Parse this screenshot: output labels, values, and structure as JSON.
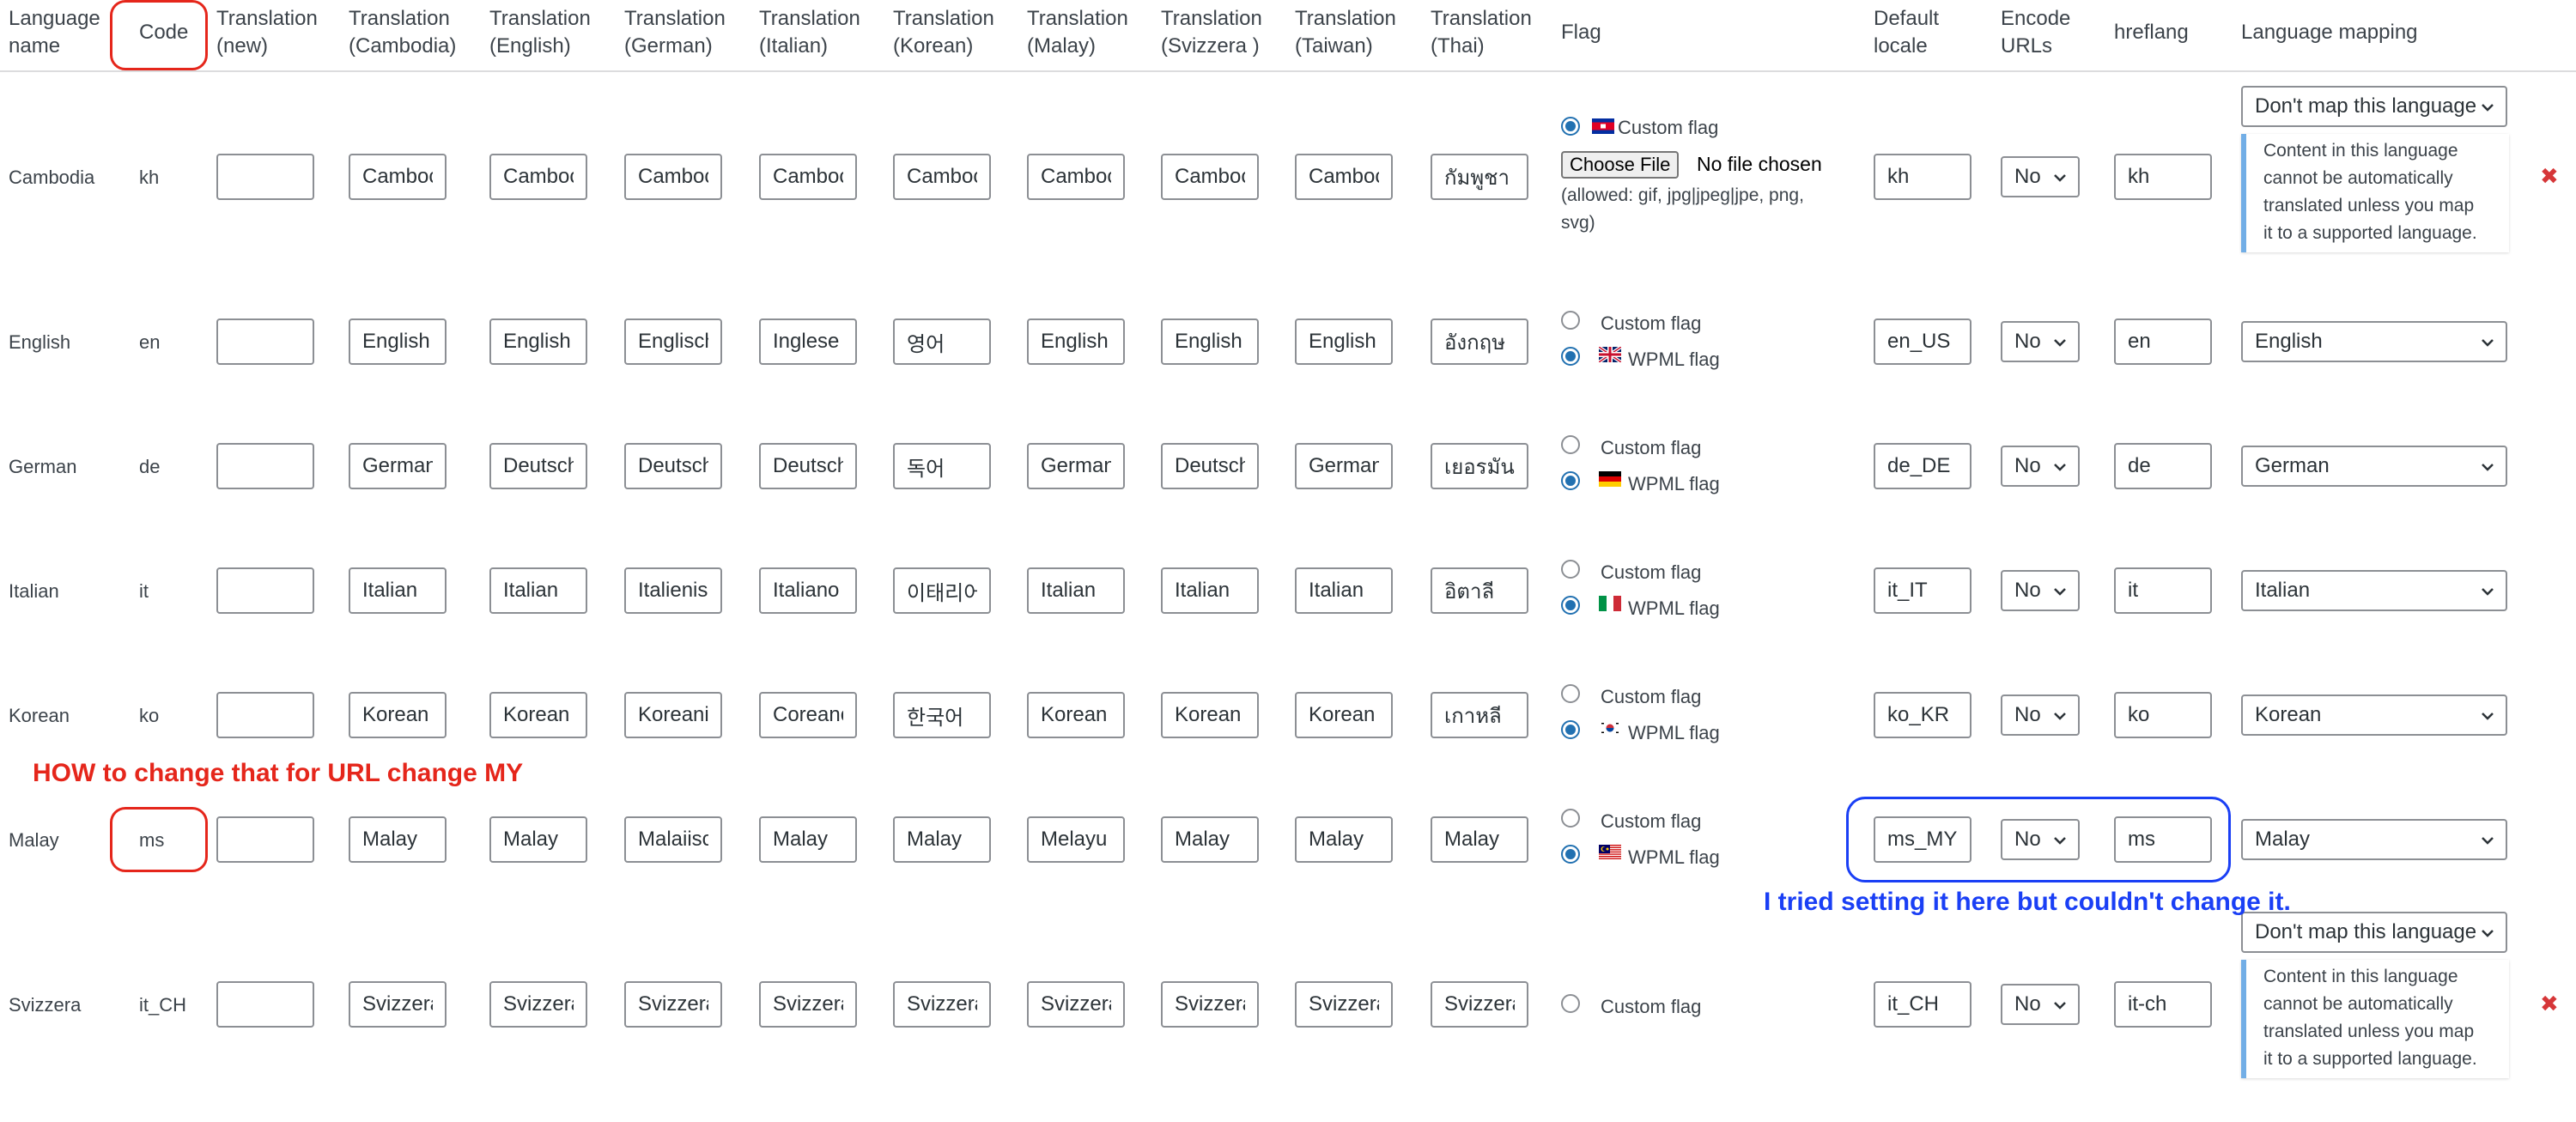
{
  "headers": {
    "name": [
      "Language",
      "name"
    ],
    "code": [
      "Code"
    ],
    "t_new": [
      "Translation",
      "(new)"
    ],
    "t_cambodia": [
      "Translation",
      "(Cambodia)"
    ],
    "t_english": [
      "Translation",
      "(English)"
    ],
    "t_german": [
      "Translation",
      "(German)"
    ],
    "t_italian": [
      "Translation",
      "(Italian)"
    ],
    "t_korean": [
      "Translation",
      "(Korean)"
    ],
    "t_malay": [
      "Translation",
      "(Malay)"
    ],
    "t_svizzera": [
      "Translation",
      "(Svizzera )"
    ],
    "t_taiwan": [
      "Translation",
      "(Taiwan)"
    ],
    "t_thai": [
      "Translation",
      "(Thai)"
    ],
    "flag": [
      "Flag"
    ],
    "locale": [
      "Default",
      "locale"
    ],
    "encode": [
      "Encode",
      "URLs"
    ],
    "hreflang": [
      "hreflang"
    ],
    "mapping": [
      "Language mapping"
    ]
  },
  "flag_labels": {
    "custom": "Custom flag",
    "wpml": "WPML flag",
    "choose_file": "Choose File",
    "no_file": "No file chosen",
    "allowed_1": "(allowed: gif, jpg|jpeg|jpe, png,",
    "allowed_2": "svg)"
  },
  "mapping_note": [
    "Content in this language",
    "cannot be automatically",
    "translated unless you map",
    "it to a supported language."
  ],
  "rows": [
    {
      "name": "Cambodia",
      "code": "kh",
      "t": [
        "",
        "Camboc",
        "Camboc",
        "Camboc",
        "Camboc",
        "Camboc",
        "Camboc",
        "Camboc",
        "Camboc",
        "กัมพูชา"
      ],
      "locale": "kh",
      "encode": "No",
      "hreflang": "kh",
      "mapping": "Don't map this language",
      "flag_mode": "custom-file",
      "flag_icon": "cambodia-flag"
    },
    {
      "name": "English",
      "code": "en",
      "t": [
        "",
        "English",
        "English",
        "Englisch",
        "Inglese",
        "영어",
        "English",
        "English",
        "English",
        "อังกฤษ"
      ],
      "locale": "en_US",
      "encode": "No",
      "hreflang": "en",
      "mapping": "English",
      "flag_mode": "wpml",
      "flag_icon": "uk-flag"
    },
    {
      "name": "German",
      "code": "de",
      "t": [
        "",
        "German",
        "Deutsch",
        "Deutsch",
        "Deutsch",
        "독어",
        "German",
        "Deutsch",
        "German",
        "เยอรมัน"
      ],
      "locale": "de_DE",
      "encode": "No",
      "hreflang": "de",
      "mapping": "German",
      "flag_mode": "wpml",
      "flag_icon": "germany-flag"
    },
    {
      "name": "Italian",
      "code": "it",
      "t": [
        "",
        "Italian",
        "Italian",
        "Italienisc",
        "Italiano",
        "이태리어",
        "Italian",
        "Italian",
        "Italian",
        "อิตาลี"
      ],
      "locale": "it_IT",
      "encode": "No",
      "hreflang": "it",
      "mapping": "Italian",
      "flag_mode": "wpml",
      "flag_icon": "italy-flag"
    },
    {
      "name": "Korean",
      "code": "ko",
      "t": [
        "",
        "Korean",
        "Korean",
        "Koreanis",
        "Coreanc",
        "한국어",
        "Korean",
        "Korean",
        "Korean",
        "เกาหลี"
      ],
      "locale": "ko_KR",
      "encode": "No",
      "hreflang": "ko",
      "mapping": "Korean",
      "flag_mode": "wpml",
      "flag_icon": "korea-flag"
    },
    {
      "name": "Malay",
      "code": "ms",
      "t": [
        "",
        "Malay",
        "Malay",
        "Malaiisc",
        "Malay",
        "Malay",
        "Melayu",
        "Malay",
        "Malay",
        "Malay"
      ],
      "locale": "ms_MY",
      "encode": "No",
      "hreflang": "ms",
      "mapping": "Malay",
      "flag_mode": "wpml",
      "flag_icon": "malaysia-flag"
    },
    {
      "name": "Svizzera",
      "code": "it_CH",
      "t": [
        "",
        "Svizzera",
        "Svizzera",
        "Svizzera",
        "Svizzera",
        "Svizzera",
        "Svizzera",
        "Svizzera",
        "Svizzera",
        "Svizzera"
      ],
      "locale": "it_CH",
      "encode": "No",
      "hreflang": "it-ch",
      "mapping": "Don't map this language",
      "flag_mode": "custom",
      "flag_icon": ""
    }
  ],
  "annotations": {
    "red": "HOW to change that for URL change MY",
    "blue": "I tried setting it here but couldn't change it."
  },
  "colors": {
    "annotation_red": "#e5261b",
    "annotation_blue": "#1a3ff5",
    "radio_selected": "#2271b1",
    "note_border": "#72aee6",
    "delete_icon": "#d63638"
  }
}
